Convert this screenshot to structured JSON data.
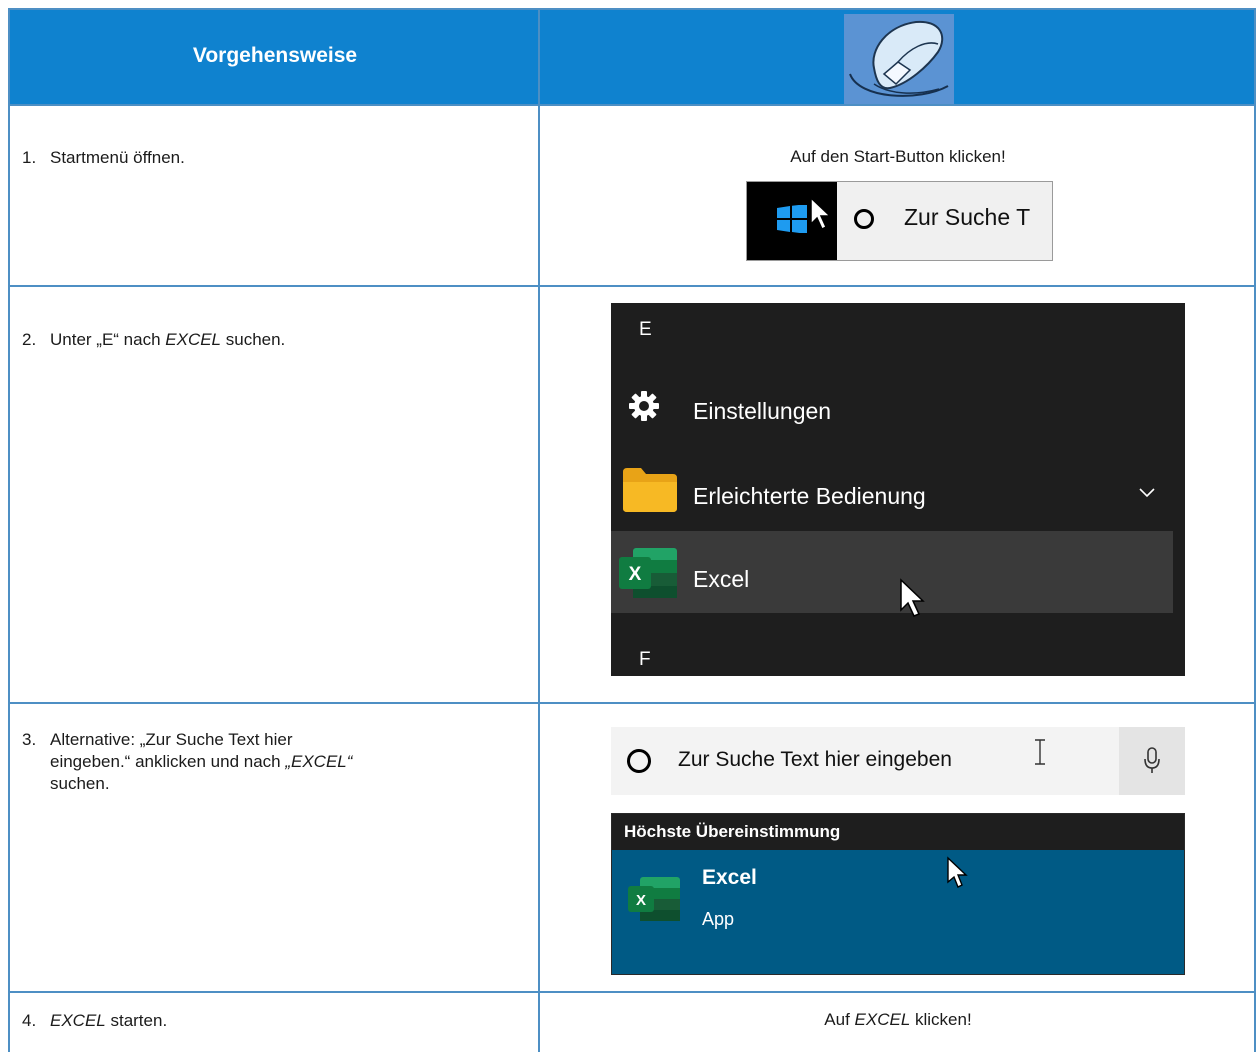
{
  "header": {
    "title": "Vorgehensweise",
    "image": "mouse-icon"
  },
  "steps": [
    {
      "number": "1.",
      "text": "Startmenü öffnen.",
      "instruction": "Auf den Start-Button klicken!"
    },
    {
      "number": "2.",
      "text_parts": [
        "Unter „E“ nach ",
        "EXCEL",
        " suchen."
      ]
    },
    {
      "number": "3.",
      "text_lines": [
        "Alternative: „Zur Suche Text hier",
        "eingeben.“ anklicken und nach ",
        "„EXCEL“",
        "suchen."
      ]
    },
    {
      "number": "4.",
      "text_parts": [
        "EXCEL",
        " starten."
      ],
      "instruction_parts": [
        "Auf ",
        "EXCEL",
        " klicken!"
      ]
    }
  ],
  "screenshot_taskbar": {
    "search_text": "Zur Suche T",
    "icons": [
      "windows-logo-icon",
      "cursor-icon",
      "cortana-circle-icon"
    ]
  },
  "screenshot_startmenu": {
    "letter_e": "E",
    "items": [
      {
        "label": "Einstellungen",
        "icon": "gear-icon"
      },
      {
        "label": "Erleichterte Bedienung",
        "icon": "folder-icon",
        "expand": "chevron-down-icon"
      },
      {
        "label": "Excel",
        "icon": "excel-icon",
        "highlighted": true
      }
    ],
    "letter_f": "F"
  },
  "screenshot_search": {
    "search_placeholder": "Zur Suche Text hier eingeben",
    "section_header": "Höchste Übereinstimmung",
    "result_name": "Excel",
    "result_type": "App",
    "icons": [
      "cortana-circle-icon",
      "text-cursor-icon",
      "microphone-icon",
      "excel-icon"
    ]
  },
  "colors": {
    "header_bg": "#0f82cf",
    "grid_line": "#4d8fc4",
    "startmenu_bg": "#1e1e1e",
    "result_bg": "#005a85"
  }
}
